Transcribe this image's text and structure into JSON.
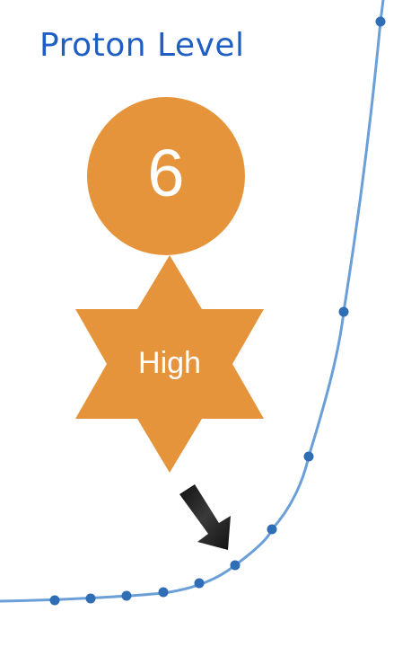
{
  "title": "Proton Level",
  "level": {
    "value": "6",
    "status": "High"
  },
  "colors": {
    "title": "#1f5fc4",
    "badge": "#e6943b",
    "curve": "#6a9fd8",
    "points": "#2f6db5",
    "arrow": "#1a1a1a"
  },
  "icons": {
    "indicator": "arrow-down-right-icon"
  }
}
